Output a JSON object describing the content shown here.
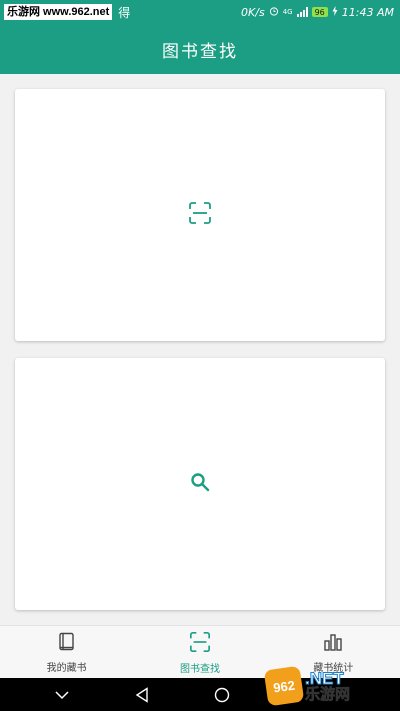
{
  "status_bar": {
    "watermark": "乐游网 www.962.net",
    "extra_text": "得",
    "speed": "0K/s",
    "network": "4G",
    "battery": "96",
    "time": "11:43 AM"
  },
  "app_bar": {
    "title": "图书查找"
  },
  "cards": [
    {
      "icon": "scan-frame-icon"
    },
    {
      "icon": "search-icon"
    }
  ],
  "bottom_nav": {
    "items": [
      {
        "label": "我的藏书",
        "icon": "book-icon",
        "active": false
      },
      {
        "label": "图书查找",
        "icon": "scan-frame-icon",
        "active": true
      },
      {
        "label": "藏书统计",
        "icon": "bar-chart-icon",
        "active": false
      }
    ]
  },
  "system_nav": [
    "chevron-down-icon",
    "back-triangle-icon",
    "home-circle-icon"
  ],
  "watermark_bottom": {
    "logo": "962",
    "text_top": ".NET",
    "text_bottom": "乐游网"
  },
  "colors": {
    "primary": "#1b9e84",
    "background": "#f1f1f1",
    "card": "#ffffff"
  }
}
